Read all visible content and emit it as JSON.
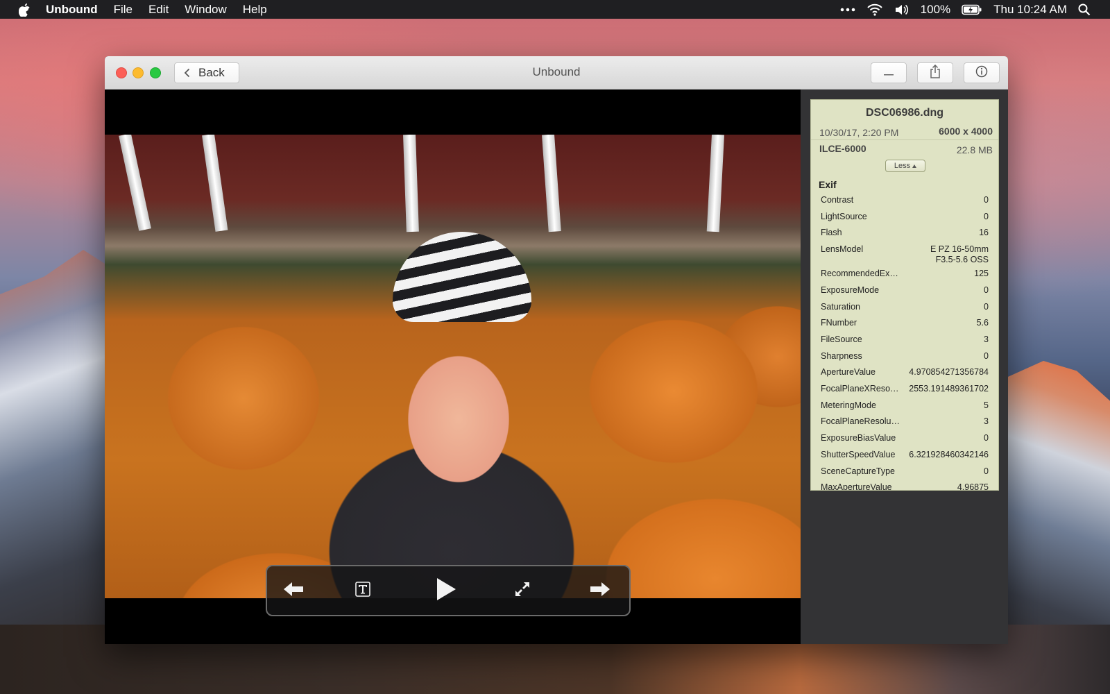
{
  "menubar": {
    "app_name": "Unbound",
    "items": [
      "File",
      "Edit",
      "Window",
      "Help"
    ],
    "battery": "100%",
    "clock": "Thu 10:24 AM"
  },
  "window": {
    "title": "Unbound",
    "back_label": "Back"
  },
  "info": {
    "file_name": "DSC06986.dng",
    "date": "10/30/17, 2:20 PM",
    "dimensions": "6000 x 4000",
    "camera": "ILCE-6000",
    "file_size": "22.8 MB",
    "less_label": "Less",
    "exif_heading": "Exif",
    "exif": [
      {
        "k": "Contrast",
        "v": "0"
      },
      {
        "k": "LightSource",
        "v": "0"
      },
      {
        "k": "Flash",
        "v": "16"
      },
      {
        "k": "LensModel",
        "v": "E PZ 16-50mm F3.5-5.6 OSS"
      },
      {
        "k": "RecommendedEx…",
        "v": "125"
      },
      {
        "k": "ExposureMode",
        "v": "0"
      },
      {
        "k": "Saturation",
        "v": "0"
      },
      {
        "k": "FNumber",
        "v": "5.6"
      },
      {
        "k": "FileSource",
        "v": "3"
      },
      {
        "k": "Sharpness",
        "v": "0"
      },
      {
        "k": "ApertureValue",
        "v": "4.970854271356784"
      },
      {
        "k": "FocalPlaneXReso…",
        "v": "2553.191489361702"
      },
      {
        "k": "MeteringMode",
        "v": "5"
      },
      {
        "k": "FocalPlaneResolu…",
        "v": "3"
      },
      {
        "k": "ExposureBiasValue",
        "v": "0"
      },
      {
        "k": "ShutterSpeedValue",
        "v": "6.321928460342146"
      },
      {
        "k": "SceneCaptureType",
        "v": "0"
      },
      {
        "k": "MaxApertureValue",
        "v": "4.96875"
      }
    ]
  },
  "icons": {
    "apple": "apple-icon",
    "more": "ellipsis-icon",
    "wifi": "wifi-icon",
    "volume": "volume-icon",
    "battery": "battery-charging-icon",
    "search": "search-icon"
  }
}
